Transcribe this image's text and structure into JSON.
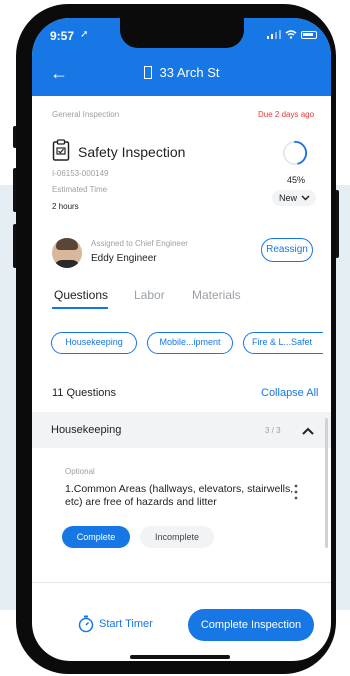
{
  "status": {
    "time": "9:57"
  },
  "appbar": {
    "title": "33 Arch St"
  },
  "inspection": {
    "category": "General Inspection",
    "due": "Due 2 days ago",
    "title": "Safety Inspection",
    "id": "I-06153-000149",
    "est_label": "Estimated Time",
    "est_value": "2 hours",
    "progress_label": "45%",
    "progress": 0.45,
    "status": "New"
  },
  "assignment": {
    "label": "Assigned to Chief Engineer",
    "name": "Eddy Engineer",
    "reassign_label": "Reassign"
  },
  "tabs": [
    {
      "label": "Questions"
    },
    {
      "label": "Labor"
    },
    {
      "label": "Materials"
    }
  ],
  "chips": [
    {
      "label": "Housekeeping"
    },
    {
      "label": "Mobile...ipment"
    },
    {
      "label": "Fire & L...Safet"
    }
  ],
  "questions": {
    "count_label": "11 Questions",
    "collapse_label": "Collapse All",
    "section_title": "Housekeeping",
    "section_progress": "3 / 3",
    "item": {
      "optional": "Optional",
      "text": "1.Common Areas (hallways, elevators, stairwells, etc) are free of hazards and litter",
      "complete_label": "Complete",
      "incomplete_label": "Incomplete"
    }
  },
  "footer": {
    "timer_label": "Start Timer",
    "complete_label": "Complete Inspection"
  },
  "colors": {
    "accent": "#1677e5",
    "due": "#e53935"
  }
}
